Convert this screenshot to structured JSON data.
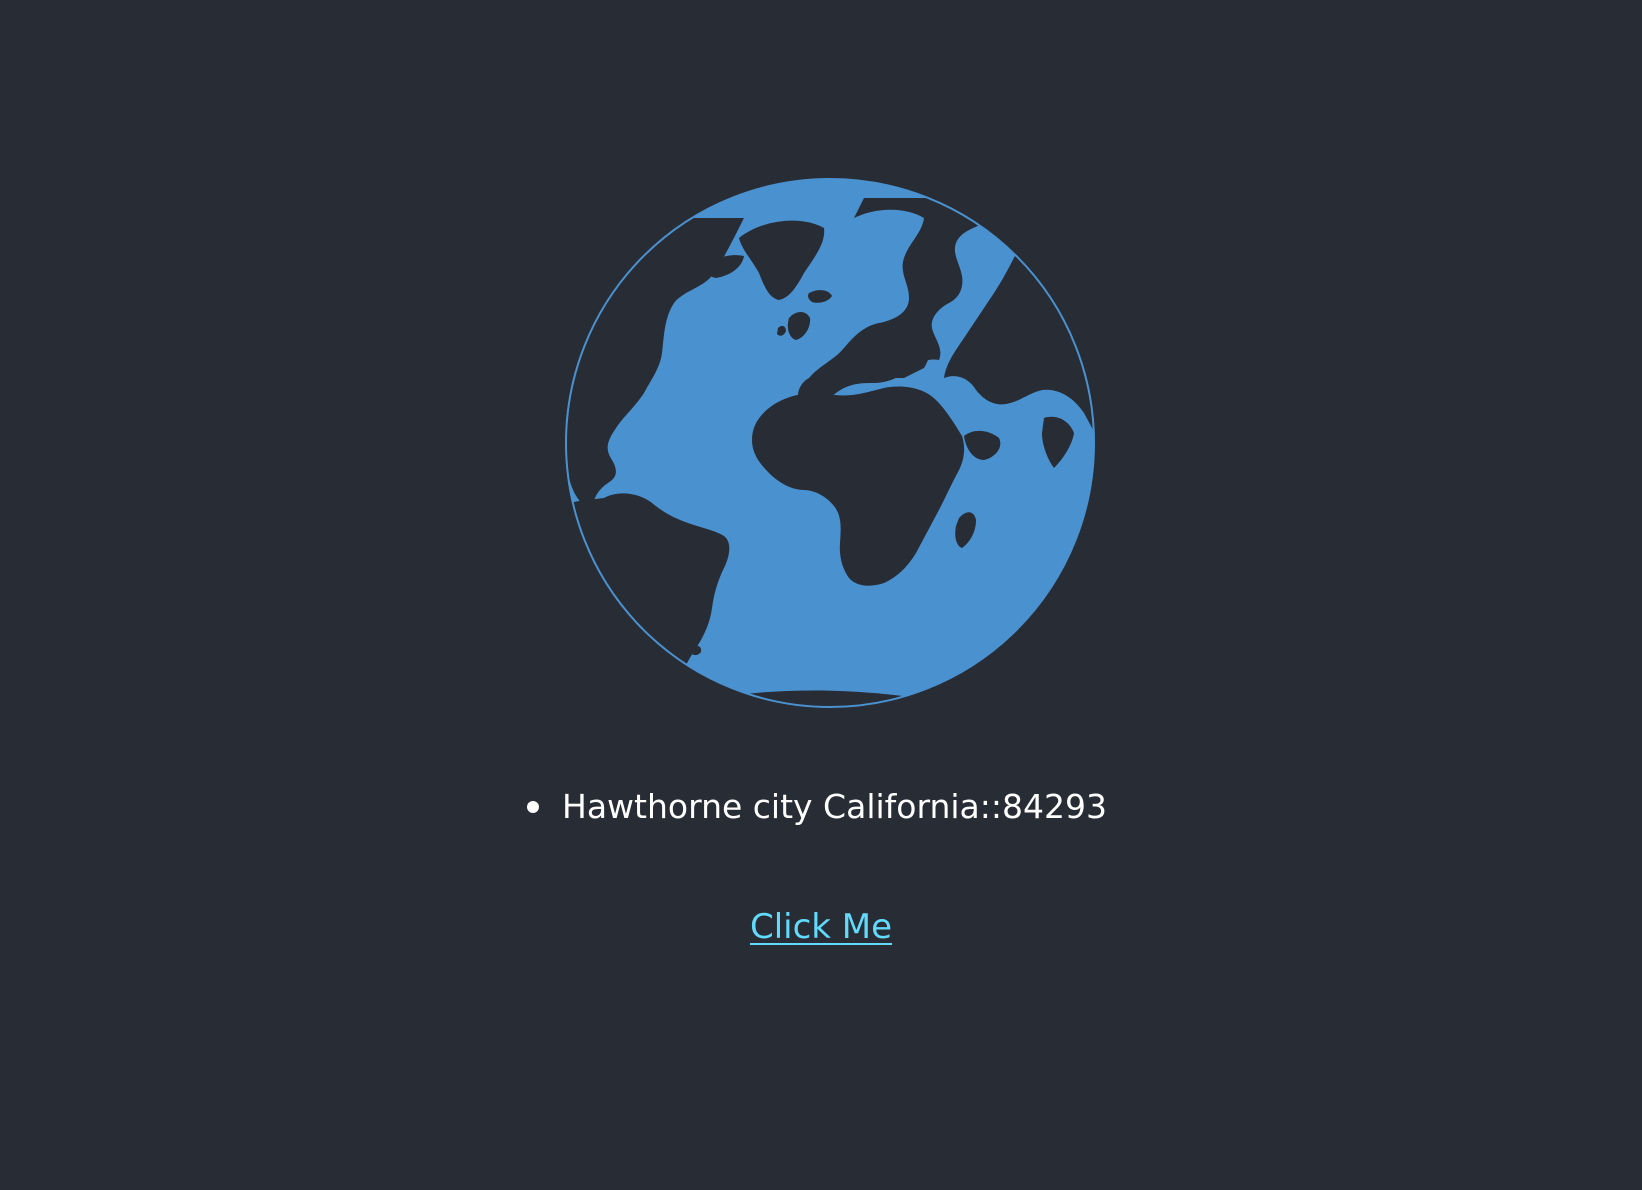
{
  "colors": {
    "background": "#282c34",
    "globe": "#4a91d0",
    "text": "#ffffff",
    "link": "#61dafb"
  },
  "icon": "earth-globe-icon",
  "locations": [
    {
      "label": "Hawthorne city California::84293"
    }
  ],
  "link": {
    "label": "Click Me"
  }
}
